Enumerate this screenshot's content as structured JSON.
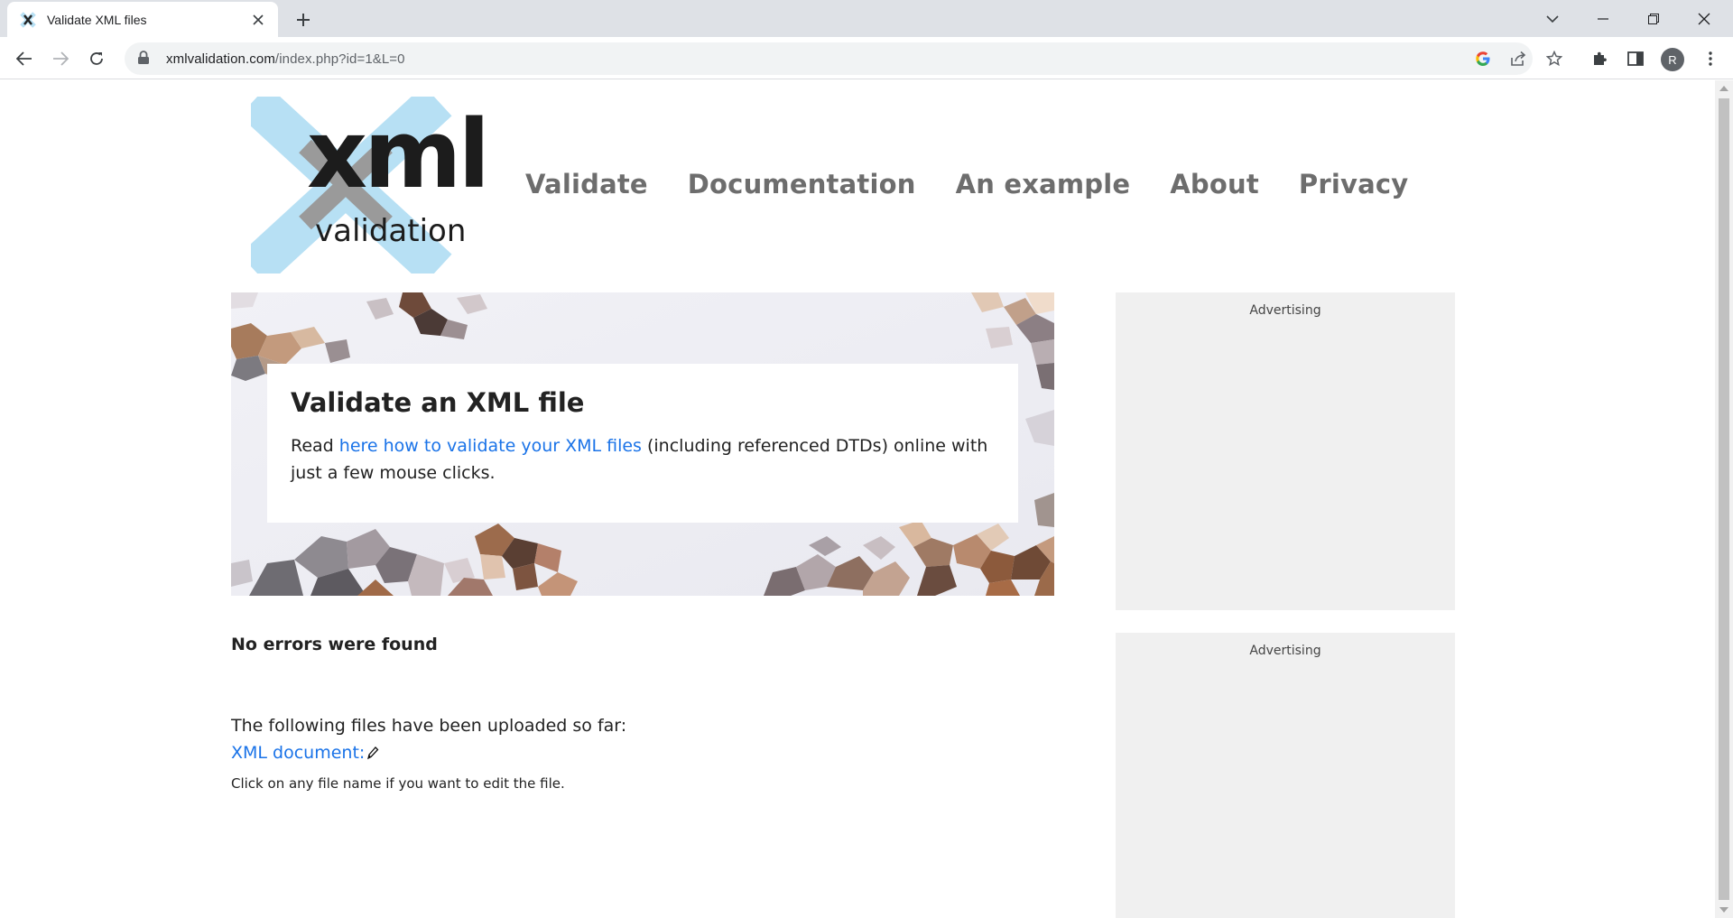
{
  "browser": {
    "tab_title": "Validate XML files",
    "url_host": "xmlvalidation.com",
    "url_path": "/index.php?id=1&L=0",
    "profile_initial": "R"
  },
  "logo": {
    "brand": "xml",
    "tagline": "validation"
  },
  "nav": {
    "items": [
      "Validate",
      "Documentation",
      "An example",
      "About",
      "Privacy"
    ]
  },
  "hero": {
    "title": "Validate an XML file",
    "text_before": "Read ",
    "link_text": "here how to validate your XML files",
    "text_after": " (including referenced DTDs) online with just a few mouse clicks."
  },
  "result": {
    "status": "No errors were found",
    "uploaded_label": "The following files have been uploaded so far:",
    "file_link": "XML document:",
    "hint": "Click on any file name if you want to edit the file."
  },
  "ads": {
    "label_1": "Advertising",
    "label_2": "Advertising"
  },
  "colors": {
    "link": "#1a73e8",
    "logo_light_blue": "#b7e0f4",
    "logo_gray": "#9a9a9a",
    "nav_gray": "#6d6d6d"
  }
}
